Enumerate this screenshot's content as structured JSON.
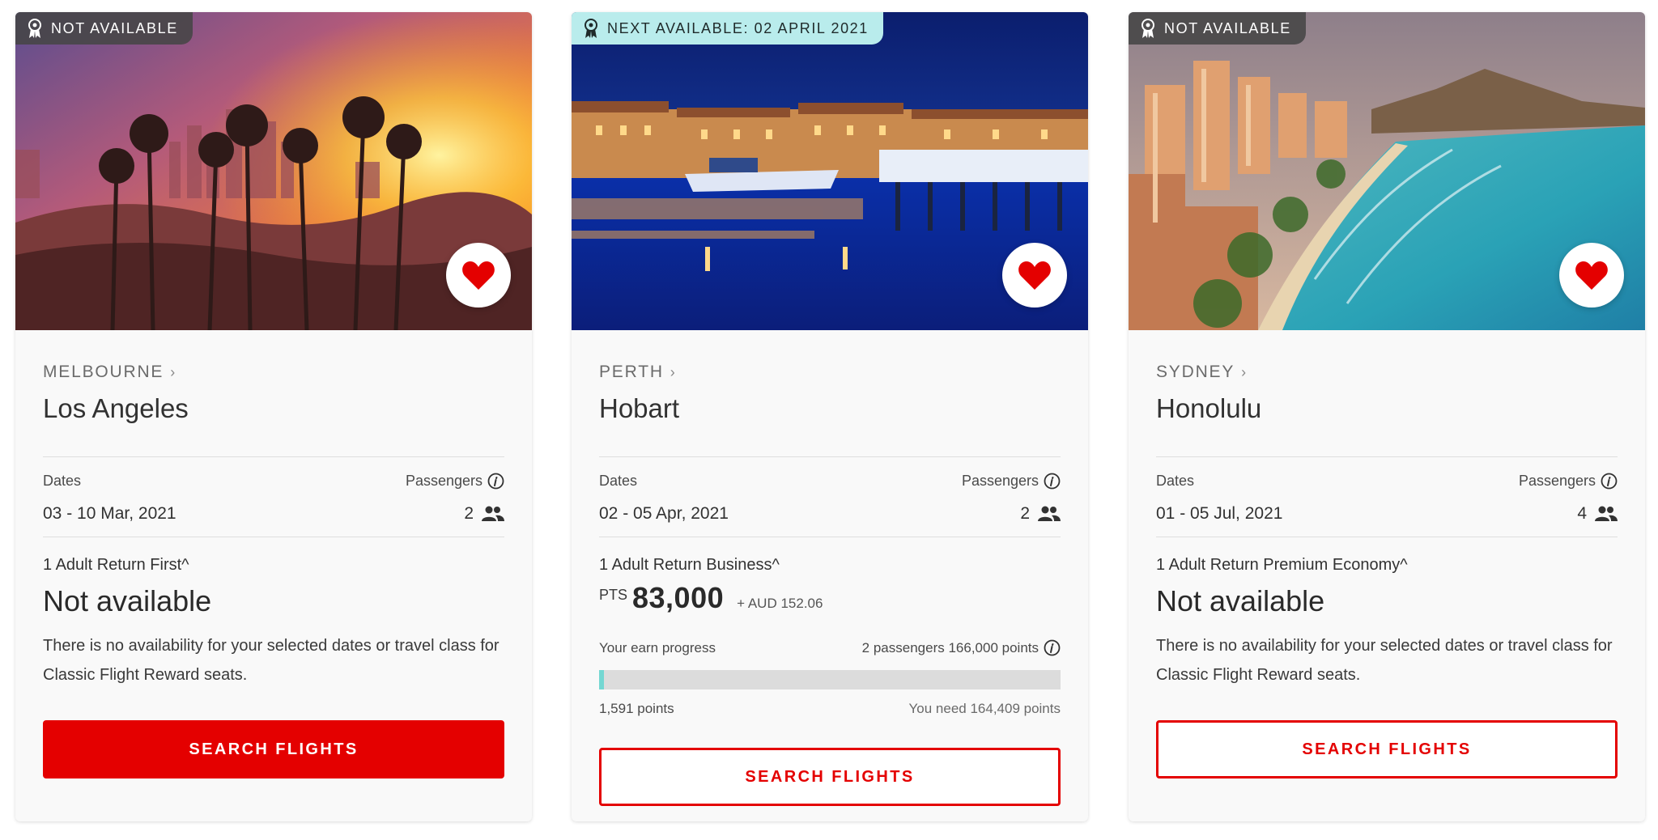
{
  "cards": [
    {
      "badge": "NOT AVAILABLE",
      "origin": "MELBOURNE",
      "destination": "Los Angeles",
      "dates_label": "Dates",
      "dates": "03 - 10 Mar, 2021",
      "passengers_label": "Passengers",
      "passengers": "2",
      "fare": "1 Adult Return First^",
      "status": "Not available",
      "message": "There is no availability for your selected dates or travel class for Classic Flight Reward seats.",
      "button": "SEARCH FLIGHTS"
    },
    {
      "badge": "NEXT AVAILABLE: 02 APRIL 2021",
      "origin": "PERTH",
      "destination": "Hobart",
      "dates_label": "Dates",
      "dates": "02 - 05 Apr, 2021",
      "passengers_label": "Passengers",
      "passengers": "2",
      "fare": "1 Adult Return Business^",
      "price_prefix": "PTS",
      "price_points": "83,000",
      "price_cash": "+ AUD 152.06",
      "earn_label": "Your earn progress",
      "earn_summary": "2 passengers 166,000 points",
      "earned": "1,591 points",
      "needed": "You need 164,409 points",
      "progress_fraction": 0.0096,
      "button": "SEARCH FLIGHTS"
    },
    {
      "badge": "NOT AVAILABLE",
      "origin": "SYDNEY",
      "destination": "Honolulu",
      "dates_label": "Dates",
      "dates": "01 - 05 Jul, 2021",
      "passengers_label": "Passengers",
      "passengers": "4",
      "fare": "1 Adult Return Premium Economy^",
      "status": "Not available",
      "message": "There is no availability for your selected dates or travel class for Classic Flight Reward seats.",
      "button": "SEARCH FLIGHTS"
    }
  ],
  "colors": {
    "brand_red": "#e40000",
    "progress_teal": "#74d7d2",
    "badge_next_bg": "#b9ecec",
    "badge_na_bg": "#464646"
  },
  "icons": [
    "award-ribbon-icon",
    "heart-icon",
    "chevron-right-icon",
    "info-icon",
    "people-icon"
  ]
}
